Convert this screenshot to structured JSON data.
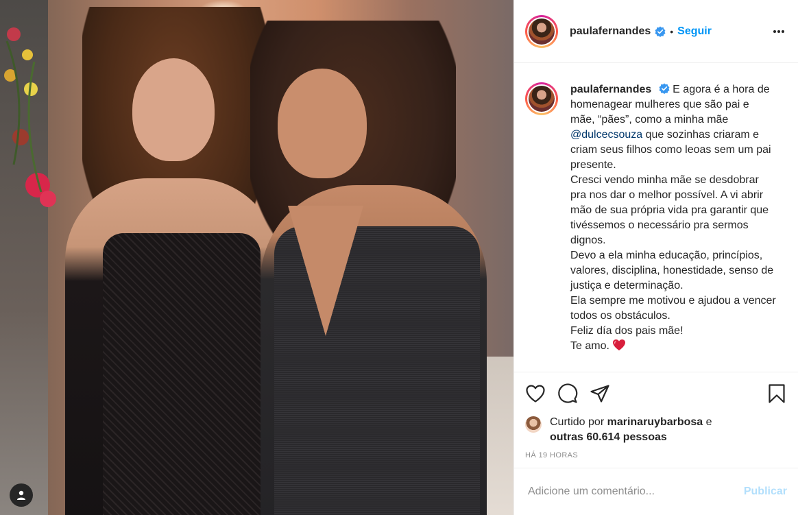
{
  "post": {
    "username": "paulafernandes",
    "verified": true,
    "separator": "•",
    "follow_label": "Seguir",
    "more_icon": "more-horizontal-icon"
  },
  "caption": {
    "username": "paulafernandes",
    "part1": "E agora é a hora de homenagear mulheres que são pai e mãe, “pães”, como a minha mãe ",
    "mention": "@dulcecsouza",
    "part2": " que sozinhas criaram e criam seus filhos como leoas sem um pai presente.",
    "line2": "Cresci vendo minha mãe se desdobrar pra nos dar o melhor possível. A vi abrir mão de sua própria vida pra garantir que tivéssemos o necessário pra sermos dignos.",
    "line3": "Devo a ela minha educação, princípios, valores, disciplina, honestidade, senso de justiça e determinação.",
    "line4": "Ela sempre me motivou e ajudou a vencer todos os obstáculos.",
    "line5": "Feliz día dos pais mãe!",
    "line6": "Te amo.",
    "emoji": "heart-emoji"
  },
  "likes": {
    "prefix": "Curtido por ",
    "user": "marinaruybarbosa",
    "conjunction": " e",
    "others": "outras 60.614 pessoas"
  },
  "timestamp": "HÁ 19 HORAS",
  "comment": {
    "placeholder": "Adicione um comentário...",
    "publish_label": "Publicar"
  },
  "colors": {
    "accent": "#0095f6",
    "publish_disabled": "#b2dffc",
    "mention": "#00376b",
    "muted": "#8e8e8e"
  },
  "icons": [
    "heart-icon",
    "comment-icon",
    "share-icon",
    "bookmark-icon",
    "verified-badge-icon",
    "user-tag-icon"
  ]
}
